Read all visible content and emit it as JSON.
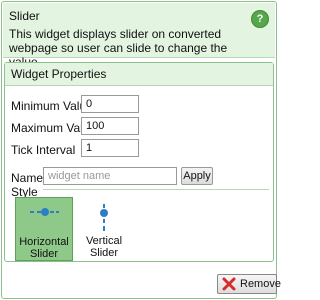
{
  "header": {
    "title": "Slider",
    "description": "This widget displays slider on converted webpage so user can slide to change the value.",
    "help_icon": "help-icon"
  },
  "properties": {
    "section_title": "Widget Properties",
    "minimum_value": {
      "label": "Minimum Value",
      "value": "0"
    },
    "maximum_value": {
      "label": "Maximum Value",
      "value": "100"
    },
    "tick_interval": {
      "label": "Tick Interval",
      "value": "1"
    },
    "name": {
      "label": "Name",
      "placeholder": "widget name"
    },
    "apply_label": "Apply",
    "style_label": "Style",
    "styles": [
      {
        "label": "Horizontal Slider",
        "icon": "horizontal-slider-icon",
        "selected": true
      },
      {
        "label": "Vertical Slider",
        "icon": "vertical-slider-icon",
        "selected": false
      }
    ]
  },
  "footer": {
    "remove_label": "Remove",
    "remove_icon": "red-x-icon"
  },
  "colors": {
    "header_bg": "#e3f4e1",
    "accent_green": "#55a84a",
    "selected_tile": "#8fc98a",
    "slider_blue": "#2d7fc1",
    "remove_red": "#d62b2b"
  }
}
